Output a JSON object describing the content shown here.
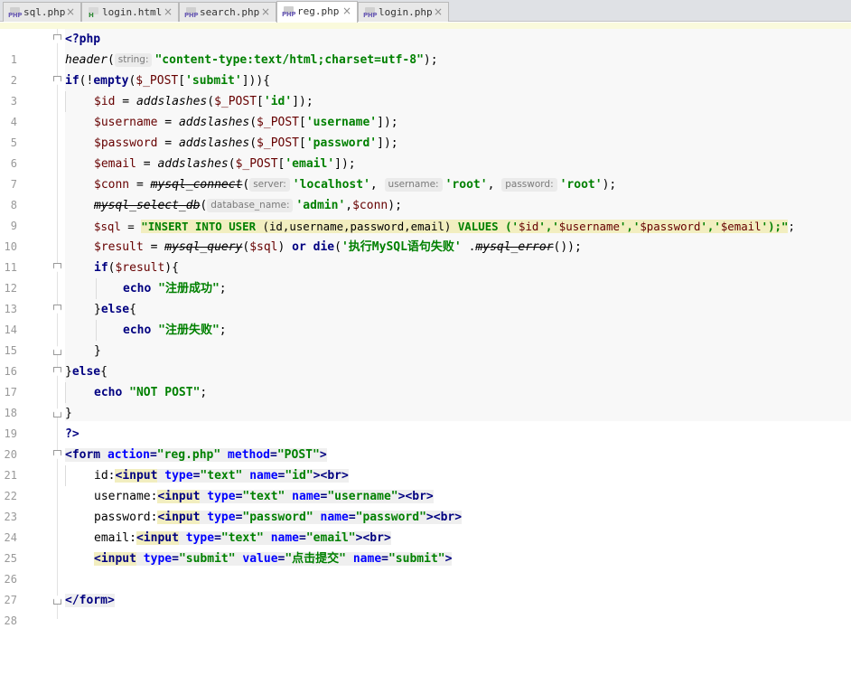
{
  "tabs": [
    {
      "icon": "PHP",
      "name": "sql.php",
      "active": false
    },
    {
      "icon": "H",
      "name": "login.html",
      "active": false
    },
    {
      "icon": "PHP",
      "name": "search.php",
      "active": false
    },
    {
      "icon": "PHP",
      "name": "reg.php",
      "active": true
    },
    {
      "icon": "PHP",
      "name": "login.php",
      "active": false
    }
  ],
  "tab_close": "×",
  "line_numbers": [
    "1",
    "2",
    "3",
    "4",
    "5",
    "6",
    "7",
    "8",
    "9",
    "10",
    "11",
    "12",
    "13",
    "14",
    "15",
    "16",
    "17",
    "18",
    "19",
    "20",
    "21",
    "22",
    "23",
    "24",
    "25",
    "26",
    "27",
    "28"
  ],
  "code": {
    "l1": {
      "t": "<?php"
    },
    "l2": {
      "fn": "header",
      "open": "(",
      "hint": "string:",
      "str": "\"content-type:text/html;charset=utf-8\"",
      "close": ");"
    },
    "l3": {
      "kw": "if",
      "p1": "(!",
      "kw2": "empty",
      "p2": "(",
      "var": "$_POST",
      "p3": "[",
      "str": "'submit'",
      "p4": "])){"
    },
    "l4": {
      "var": "$id",
      "eq": " = ",
      "fn": "addslashes",
      "p1": "(",
      "post": "$_POST",
      "p2": "[",
      "str": "'id'",
      "p3": "]);"
    },
    "l5": {
      "var": "$username",
      "eq": " = ",
      "fn": "addslashes",
      "p1": "(",
      "post": "$_POST",
      "p2": "[",
      "str": "'username'",
      "p3": "]);"
    },
    "l6": {
      "var": "$password",
      "eq": " = ",
      "fn": "addslashes",
      "p1": "(",
      "post": "$_POST",
      "p2": "[",
      "str": "'password'",
      "p3": "]);"
    },
    "l7": {
      "var": "$email",
      "eq": " = ",
      "fn": "addslashes",
      "p1": "(",
      "post": "$_POST",
      "p2": "[",
      "str": "'email'",
      "p3": "]);"
    },
    "l8": {
      "var": "$conn",
      "eq": " = ",
      "fn": "mysql_connect",
      "p1": "(",
      "h1": "server:",
      "s1": "'localhost'",
      "c1": ", ",
      "h2": "username:",
      "s2": "'root'",
      "c2": ", ",
      "h3": "password:",
      "s3": "'root'",
      "p2": ");"
    },
    "l9": {
      "fn": "mysql_select_db",
      "p1": "(",
      "h1": "database_name:",
      "s1": "'admin'",
      "c1": ",",
      "var": "$conn",
      "p2": ");"
    },
    "l10": {
      "var": "$sql",
      "eq": " = ",
      "s1": "\"INSERT INTO USER ",
      "sql": "(id,username,password,email)",
      "s2": " VALUES (",
      "q1": "'",
      "v1": "$id",
      "q2": "','",
      "v2": "$username",
      "q3": "','",
      "v3": "$password",
      "q4": "','",
      "v4": "$email",
      "q5": "');",
      "s3": "\"",
      "end": ";"
    },
    "l11": {
      "var": "$result",
      "eq": " = ",
      "fn": "mysql_query",
      "p1": "(",
      "var2": "$sql",
      "p2": ") ",
      "kw": "or",
      "sp": " ",
      "kw2": "die",
      "p3": "(",
      "str": "'执行MySQL语句失败'",
      "dot": " .",
      "fn2": "mysql_error",
      "p4": "());"
    },
    "l12": {
      "kw": "if",
      "p1": "(",
      "var": "$result",
      "p2": "){"
    },
    "l13": {
      "kw": "echo",
      "sp": " ",
      "str": "\"注册成功\"",
      "end": ";"
    },
    "l14": {
      "p1": "}",
      "kw": "else",
      "p2": "{"
    },
    "l15": {
      "kw": "echo",
      "sp": " ",
      "str": "\"注册失败\"",
      "end": ";"
    },
    "l16": {
      "t": "}"
    },
    "l17": {
      "p1": "}",
      "kw": "else",
      "p2": "{"
    },
    "l18": {
      "kw": "echo",
      "sp": " ",
      "str": "\"NOT POST\"",
      "end": ";"
    },
    "l19": {
      "t": "}"
    },
    "l20": {
      "t": "?>"
    },
    "l21": {
      "lt": "<",
      "tag": "form",
      "a1": " action",
      "eq1": "=",
      "v1": "\"reg.php\"",
      "a2": " method",
      "eq2": "=",
      "v2": "\"POST\"",
      "gt": ">"
    },
    "l22": {
      "label": "id:",
      "lt": "<",
      "tag": "input",
      "a1": " type",
      "eq1": "=",
      "v1": "\"text\"",
      "a2": " name",
      "eq2": "=",
      "v2": "\"id\"",
      "gt": ">",
      "br": "<br>"
    },
    "l23": {
      "label": "username:",
      "lt": "<",
      "tag": "input",
      "a1": " type",
      "eq1": "=",
      "v1": "\"text\"",
      "a2": " name",
      "eq2": "=",
      "v2": "\"username\"",
      "gt": ">",
      "br": "<br>"
    },
    "l24": {
      "label": "password:",
      "lt": "<",
      "tag": "input",
      "a1": " type",
      "eq1": "=",
      "v1": "\"password\"",
      "a2": " name",
      "eq2": "=",
      "v2": "\"password\"",
      "gt": ">",
      "br": "<br>"
    },
    "l25": {
      "label": "email:",
      "lt": "<",
      "tag": "input",
      "a1": " type",
      "eq1": "=",
      "v1": "\"text\"",
      "a2": " name",
      "eq2": "=",
      "v2": "\"email\"",
      "gt": ">",
      "br": "<br>"
    },
    "l26": {
      "lt": "<",
      "tag": "input",
      "a1": " type",
      "eq1": "=",
      "v1": "\"submit\"",
      "a2": " value",
      "eq2": "=",
      "v2": "\"点击提交\"",
      "a3": " name",
      "eq3": "=",
      "v3": "\"submit\"",
      "gt": ">"
    },
    "l28": {
      "t": "</form>"
    }
  }
}
